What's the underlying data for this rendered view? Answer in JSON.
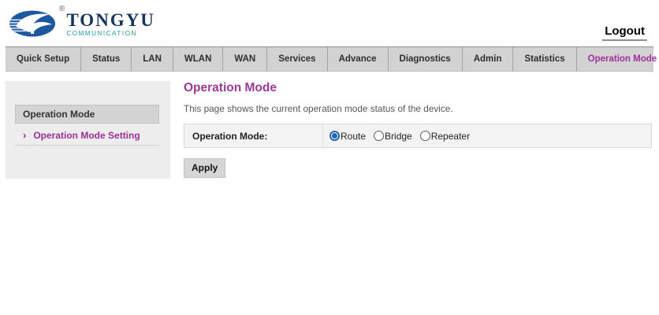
{
  "header": {
    "logo": {
      "name": "TONGYU",
      "sub": "COMMUNICATION",
      "registered": "®"
    },
    "logout_label": "Logout"
  },
  "nav": {
    "items": [
      {
        "label": "Quick Setup",
        "active": false
      },
      {
        "label": "Status",
        "active": false
      },
      {
        "label": "LAN",
        "active": false
      },
      {
        "label": "WLAN",
        "active": false
      },
      {
        "label": "WAN",
        "active": false
      },
      {
        "label": "Services",
        "active": false
      },
      {
        "label": "Advance",
        "active": false
      },
      {
        "label": "Diagnostics",
        "active": false
      },
      {
        "label": "Admin",
        "active": false
      },
      {
        "label": "Statistics",
        "active": false
      },
      {
        "label": "Operation Mode",
        "active": true
      }
    ]
  },
  "sidebar": {
    "section_title": "Operation Mode",
    "arrow_glyph": "›",
    "link_label": "Operation Mode Setting"
  },
  "main": {
    "title": "Operation Mode",
    "description": "This page shows the current operation mode status of the device.",
    "form": {
      "label": "Operation Mode:",
      "options": [
        "Route",
        "Bridge",
        "Repeater"
      ],
      "selected": "Route"
    },
    "apply_label": "Apply"
  },
  "colors": {
    "accent_magenta": "#9c3a96",
    "radio_blue": "#2565b0",
    "nav_bg": "#d2d2d2",
    "logo_navy": "#16365f",
    "logo_teal": "#1d9898"
  }
}
